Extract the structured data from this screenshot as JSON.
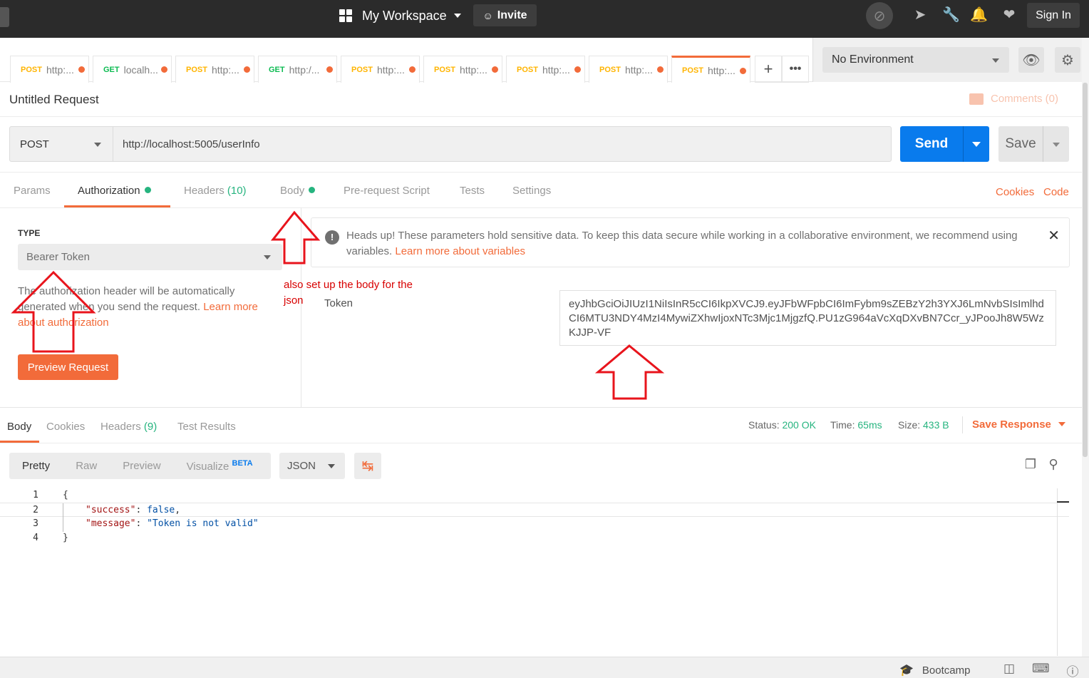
{
  "topbar": {
    "workspace": "My Workspace",
    "invite": "Invite",
    "sign_in": "Sign In",
    "icons": [
      "sync-off-icon",
      "satellite-icon",
      "wrench-icon",
      "bell-icon",
      "heart-icon"
    ]
  },
  "tabs": [
    {
      "method": "POST",
      "label": "http:..."
    },
    {
      "method": "GET",
      "label": "localh..."
    },
    {
      "method": "POST",
      "label": "http:..."
    },
    {
      "method": "GET",
      "label": "http:/..."
    },
    {
      "method": "POST",
      "label": "http:..."
    },
    {
      "method": "POST",
      "label": "http:..."
    },
    {
      "method": "POST",
      "label": "http:..."
    },
    {
      "method": "POST",
      "label": "http:..."
    },
    {
      "method": "POST",
      "label": "http:..."
    }
  ],
  "environment": {
    "selected": "No Environment"
  },
  "request": {
    "title": "Untitled Request",
    "comments": "Comments (0)",
    "method": "POST",
    "url": "http://localhost:5005/userInfo",
    "send": "Send",
    "save": "Save"
  },
  "request_tabs": {
    "params": "Params",
    "authorization": "Authorization",
    "headers": "Headers",
    "headers_count": "(10)",
    "body": "Body",
    "prerequest": "Pre-request Script",
    "tests": "Tests",
    "settings": "Settings",
    "cookies": "Cookies",
    "code": "Code"
  },
  "auth": {
    "type_label": "TYPE",
    "type_value": "Bearer Token",
    "desc_text": "The authorization header will be automatically generated when you send the request. ",
    "desc_link": "Learn more about authorization",
    "preview_button": "Preview Request",
    "notice_text": "Heads up! These parameters hold sensitive data. To keep this data secure while working in a collaborative environment, we recommend using variables. ",
    "notice_link": "Learn more about variables",
    "token_label": "Token",
    "token_value": "eyJhbGciOiJIUzI1NiIsInR5cCI6IkpXVCJ9.eyJFbWFpbCI6ImFybm9sZEBzY2h3YXJ6LmNvbSIsImlhdCI6MTU3NDY4MzI4MywiZXhwIjoxNTc3Mjc1MjgzfQ.PU1zG964aVcXqDXvBN7Ccr_yJPooJh8W5WzKJJP-VF"
  },
  "annotation": {
    "text": "also set up the body for the json"
  },
  "response": {
    "tabs": {
      "body": "Body",
      "cookies": "Cookies",
      "headers": "Headers",
      "headers_count": "(9)",
      "test_results": "Test Results"
    },
    "status_label": "Status:",
    "status_value": "200 OK",
    "time_label": "Time:",
    "time_value": "65ms",
    "size_label": "Size:",
    "size_value": "433 B",
    "save_response": "Save Response",
    "views": {
      "pretty": "Pretty",
      "raw": "Raw",
      "preview": "Preview",
      "visualize": "Visualize",
      "beta": "BETA"
    },
    "format": "JSON",
    "lines": [
      {
        "n": "1",
        "text": "{"
      },
      {
        "n": "2",
        "key": "\"success\"",
        "sep": ": ",
        "val": "false",
        "end": ","
      },
      {
        "n": "3",
        "key": "\"message\"",
        "sep": ": ",
        "val": "\"Token is not valid\"",
        "end": ""
      },
      {
        "n": "4",
        "text": "}"
      }
    ]
  },
  "footer": {
    "bootcamp": "Bootcamp"
  },
  "colors": {
    "accent": "#f26b3a",
    "send": "#097bed",
    "success": "#26b47f",
    "annotation": "#d80000"
  }
}
